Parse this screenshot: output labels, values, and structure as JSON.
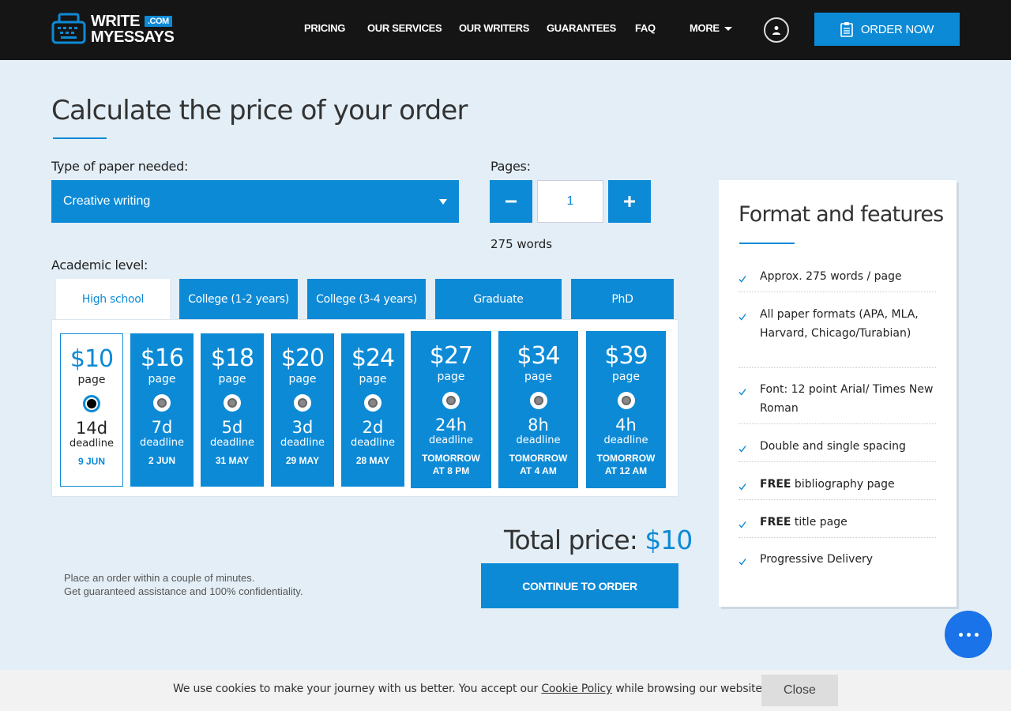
{
  "header": {
    "logo_line1": "WRITE",
    "logo_com": ".COM",
    "logo_line2": "MYESSAYS",
    "nav": [
      "PRICING",
      "OUR SERVICES",
      "OUR WRITERS",
      "GUARANTEES",
      "FAQ",
      "MORE"
    ],
    "order_now": "ORDER NOW"
  },
  "calculator": {
    "title": "Calculate the price of your order",
    "paper_label": "Type of paper needed:",
    "paper_value": "Creative writing",
    "pages_label": "Pages:",
    "pages_value": "1",
    "minus_symbol": "−",
    "plus_symbol": "+",
    "words": "275 words",
    "level_label": "Academic level:",
    "levels": [
      "High school",
      "College (1-2 years)",
      "College (3-4 years)",
      "Graduate",
      "PhD"
    ],
    "active_level": "High school",
    "cards": [
      {
        "price": "$10",
        "per": "page",
        "deadline": "14d",
        "deadline_word": "deadline",
        "date1": "9 JUN",
        "date2": ""
      },
      {
        "price": "$16",
        "per": "page",
        "deadline": "7d",
        "deadline_word": "deadline",
        "date1": "2 JUN",
        "date2": ""
      },
      {
        "price": "$18",
        "per": "page",
        "deadline": "5d",
        "deadline_word": "deadline",
        "date1": "31 MAY",
        "date2": ""
      },
      {
        "price": "$20",
        "per": "page",
        "deadline": "3d",
        "deadline_word": "deadline",
        "date1": "29 MAY",
        "date2": ""
      },
      {
        "price": "$24",
        "per": "page",
        "deadline": "2d",
        "deadline_word": "deadline",
        "date1": "28 MAY",
        "date2": ""
      },
      {
        "price": "$27",
        "per": "page",
        "deadline": "24h",
        "deadline_word": "deadline",
        "date1": "TOMORROW",
        "date2": "AT 8 PM"
      },
      {
        "price": "$34",
        "per": "page",
        "deadline": "8h",
        "deadline_word": "deadline",
        "date1": "TOMORROW",
        "date2": "AT 4 AM"
      },
      {
        "price": "$39",
        "per": "page",
        "deadline": "4h",
        "deadline_word": "deadline",
        "date1": "TOMORROW",
        "date2": "AT 12 AM"
      }
    ],
    "selected_card": "$10",
    "total_label": "Total price:",
    "total_value": "$10",
    "continue": "CONTINUE TO ORDER",
    "note_line1": "Place an order within a couple of minutes.",
    "note_line2": "Get guaranteed assistance and 100% confidentiality."
  },
  "features": {
    "title": "Format and features",
    "items": [
      {
        "bold": "",
        "text": "Approx. 275 words / page"
      },
      {
        "bold": "",
        "text": "All paper formats (APA, MLA, Harvard, Chicago/Turabian)"
      },
      {
        "bold": "",
        "text": "Font: 12 point Arial/ Times New Roman"
      },
      {
        "bold": "",
        "text": "Double and single spacing"
      },
      {
        "bold": "FREE",
        "text": " bibliography page"
      },
      {
        "bold": "FREE",
        "text": " title page"
      },
      {
        "bold": "",
        "text": "Progressive Delivery"
      }
    ]
  },
  "cookie": {
    "text_before": "We use cookies to make your journey with us better. You accept our ",
    "link": "Cookie Policy",
    "text_after": " while browsing our website.",
    "close": "Close"
  },
  "colors": {
    "accent": "#0d8ad6",
    "header_bg": "#151515",
    "page_bg": "#e3eef6"
  }
}
